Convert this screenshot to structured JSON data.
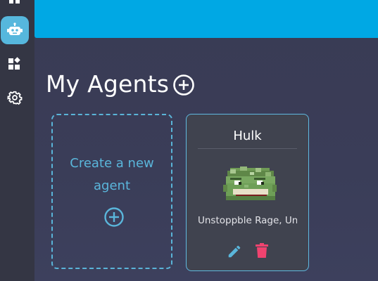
{
  "sidebar": {
    "items": [
      {
        "icon": "grid-icon",
        "active": false
      },
      {
        "icon": "robot-icon",
        "active": true
      },
      {
        "icon": "widgets-icon",
        "active": false
      },
      {
        "icon": "gear-icon",
        "active": false
      }
    ]
  },
  "main": {
    "title": "My Agents",
    "add_icon": "plus-circle-icon",
    "create_card": {
      "line1": "Create a new",
      "line2": "agent",
      "icon": "plus-circle-icon"
    },
    "agents": [
      {
        "name": "Hulk",
        "avatar": "pixel-hulk-avatar",
        "description": "Unstoppble Rage, Unbreakable Will",
        "actions": [
          "pencil-icon",
          "trash-icon"
        ]
      }
    ]
  },
  "colors": {
    "topbar": "#00a8e4",
    "sidebar": "#343644",
    "accent": "#5ab6db",
    "background": "#3a3d57",
    "delete": "#f0436f"
  }
}
